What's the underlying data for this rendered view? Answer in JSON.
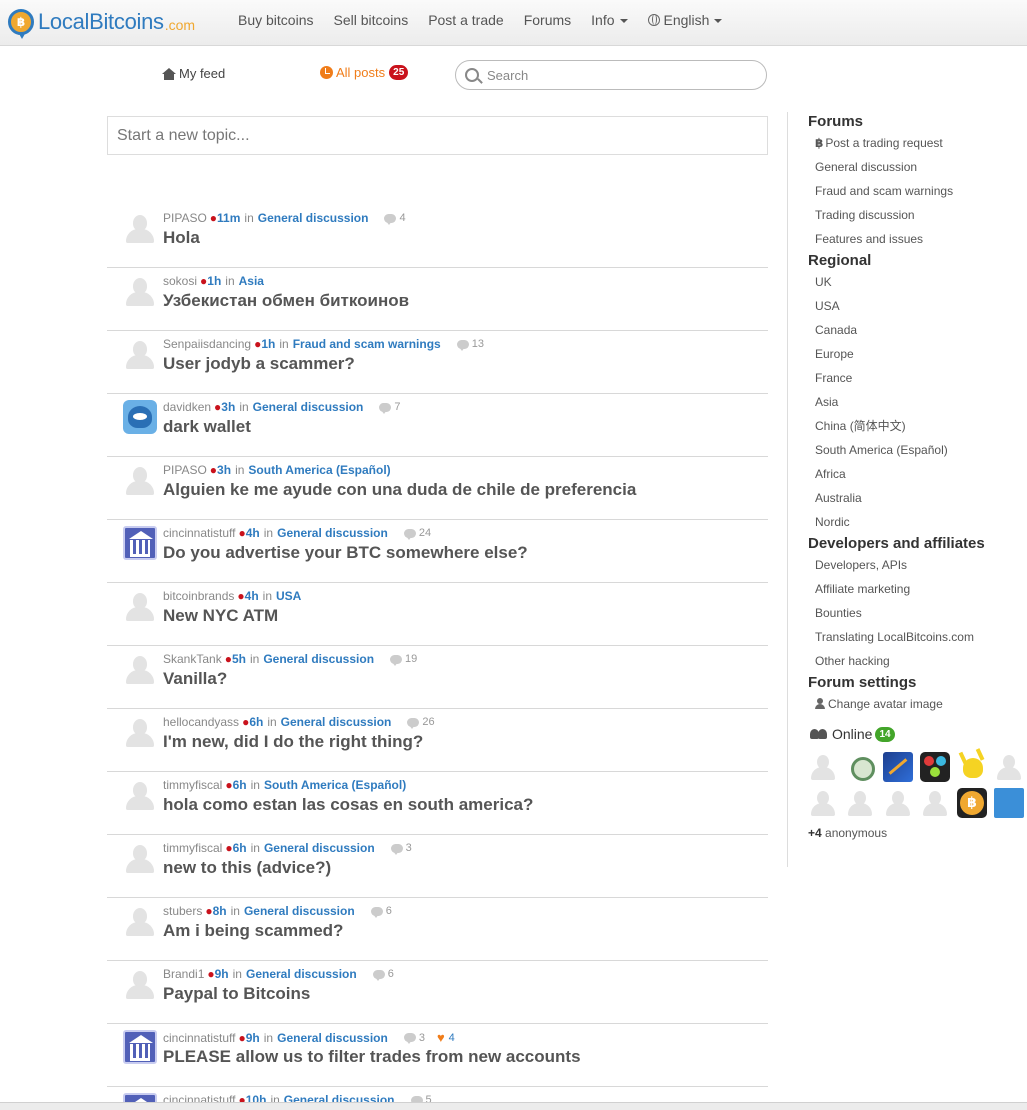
{
  "brand": {
    "name": "LocalBitcoins",
    "tld": ".com"
  },
  "nav": {
    "buy": "Buy bitcoins",
    "sell": "Sell bitcoins",
    "post": "Post a trade",
    "forums": "Forums",
    "info": "Info",
    "language": "English"
  },
  "feed": {
    "my_feed": "My feed",
    "all_posts": "All posts",
    "all_posts_count": "25",
    "search_placeholder": "Search",
    "new_topic_placeholder": "Start a new topic..."
  },
  "posts": [
    {
      "user": "PIPASO",
      "age": "11m",
      "in": "in",
      "category": "General discussion",
      "comments": "4",
      "likes": "",
      "title": "Hola",
      "avatar": "default"
    },
    {
      "user": "sokosi",
      "age": "1h",
      "in": "in",
      "category": "Asia",
      "comments": "",
      "likes": "",
      "title": "Узбекистан обмен биткоинов",
      "avatar": "default"
    },
    {
      "user": "Senpaiisdancing",
      "age": "1h",
      "in": "in",
      "category": "Fraud and scam warnings",
      "comments": "13",
      "likes": "",
      "title": "User jodyb a scammer?",
      "avatar": "default"
    },
    {
      "user": "davidken",
      "age": "3h",
      "in": "in",
      "category": "General discussion",
      "comments": "7",
      "likes": "",
      "title": "dark wallet",
      "avatar": "cat"
    },
    {
      "user": "PIPASO",
      "age": "3h",
      "in": "in",
      "category": "South America (Español)",
      "comments": "",
      "likes": "",
      "title": "Alguien ke me ayude con una duda de chile de preferencia",
      "avatar": "default"
    },
    {
      "user": "cincinnatistuff",
      "age": "4h",
      "in": "in",
      "category": "General discussion",
      "comments": "24",
      "likes": "",
      "title": "Do you advertise your BTC somewhere else?",
      "avatar": "bank"
    },
    {
      "user": "bitcoinbrands",
      "age": "4h",
      "in": "in",
      "category": "USA",
      "comments": "",
      "likes": "",
      "title": "New NYC ATM",
      "avatar": "default"
    },
    {
      "user": "SkankTank",
      "age": "5h",
      "in": "in",
      "category": "General discussion",
      "comments": "19",
      "likes": "",
      "title": "Vanilla?",
      "avatar": "default"
    },
    {
      "user": "hellocandyass",
      "age": "6h",
      "in": "in",
      "category": "General discussion",
      "comments": "26",
      "likes": "",
      "title": "I'm new, did I do the right thing?",
      "avatar": "default"
    },
    {
      "user": "timmyfiscal",
      "age": "6h",
      "in": "in",
      "category": "South America (Español)",
      "comments": "",
      "likes": "",
      "title": "hola como estan las cosas en south america?",
      "avatar": "default"
    },
    {
      "user": "timmyfiscal",
      "age": "6h",
      "in": "in",
      "category": "General discussion",
      "comments": "3",
      "likes": "",
      "title": "new to this (advice?)",
      "avatar": "default"
    },
    {
      "user": "stubers",
      "age": "8h",
      "in": "in",
      "category": "General discussion",
      "comments": "6",
      "likes": "",
      "title": "Am i being scammed?",
      "avatar": "default"
    },
    {
      "user": "Brandi1",
      "age": "9h",
      "in": "in",
      "category": "General discussion",
      "comments": "6",
      "likes": "",
      "title": "Paypal to Bitcoins",
      "avatar": "default"
    },
    {
      "user": "cincinnatistuff",
      "age": "9h",
      "in": "in",
      "category": "General discussion",
      "comments": "3",
      "likes": "4",
      "title": "PLEASE allow us to filter trades from new accounts",
      "avatar": "bank"
    },
    {
      "user": "cincinnatistuff",
      "age": "10h",
      "in": "in",
      "category": "General discussion",
      "comments": "5",
      "likes": "",
      "title": "",
      "avatar": "bank"
    }
  ],
  "sidebar": {
    "forums_heading": "Forums",
    "forums": [
      "Post a trading request",
      "General discussion",
      "Fraud and scam warnings",
      "Trading discussion",
      "Features and issues"
    ],
    "regional_heading": "Regional",
    "regional": [
      "UK",
      "USA",
      "Canada",
      "Europe",
      "France",
      "Asia",
      "China (简体中文)",
      "South America (Español)",
      "Africa",
      "Australia",
      "Nordic"
    ],
    "dev_heading": "Developers and affiliates",
    "dev": [
      "Developers, APIs",
      "Affiliate marketing",
      "Bounties",
      "Translating LocalBitcoins.com",
      "Other hacking"
    ],
    "settings_heading": "Forum settings",
    "settings": [
      "Change avatar image"
    ],
    "online_label": "Online",
    "online_count": "14",
    "anon_count": "+4",
    "anon_label": "anonymous"
  },
  "colors": {
    "brand_blue": "#2f7bbf",
    "orange": "#f07d1a",
    "red": "#c9121c",
    "green": "#43a52a"
  }
}
